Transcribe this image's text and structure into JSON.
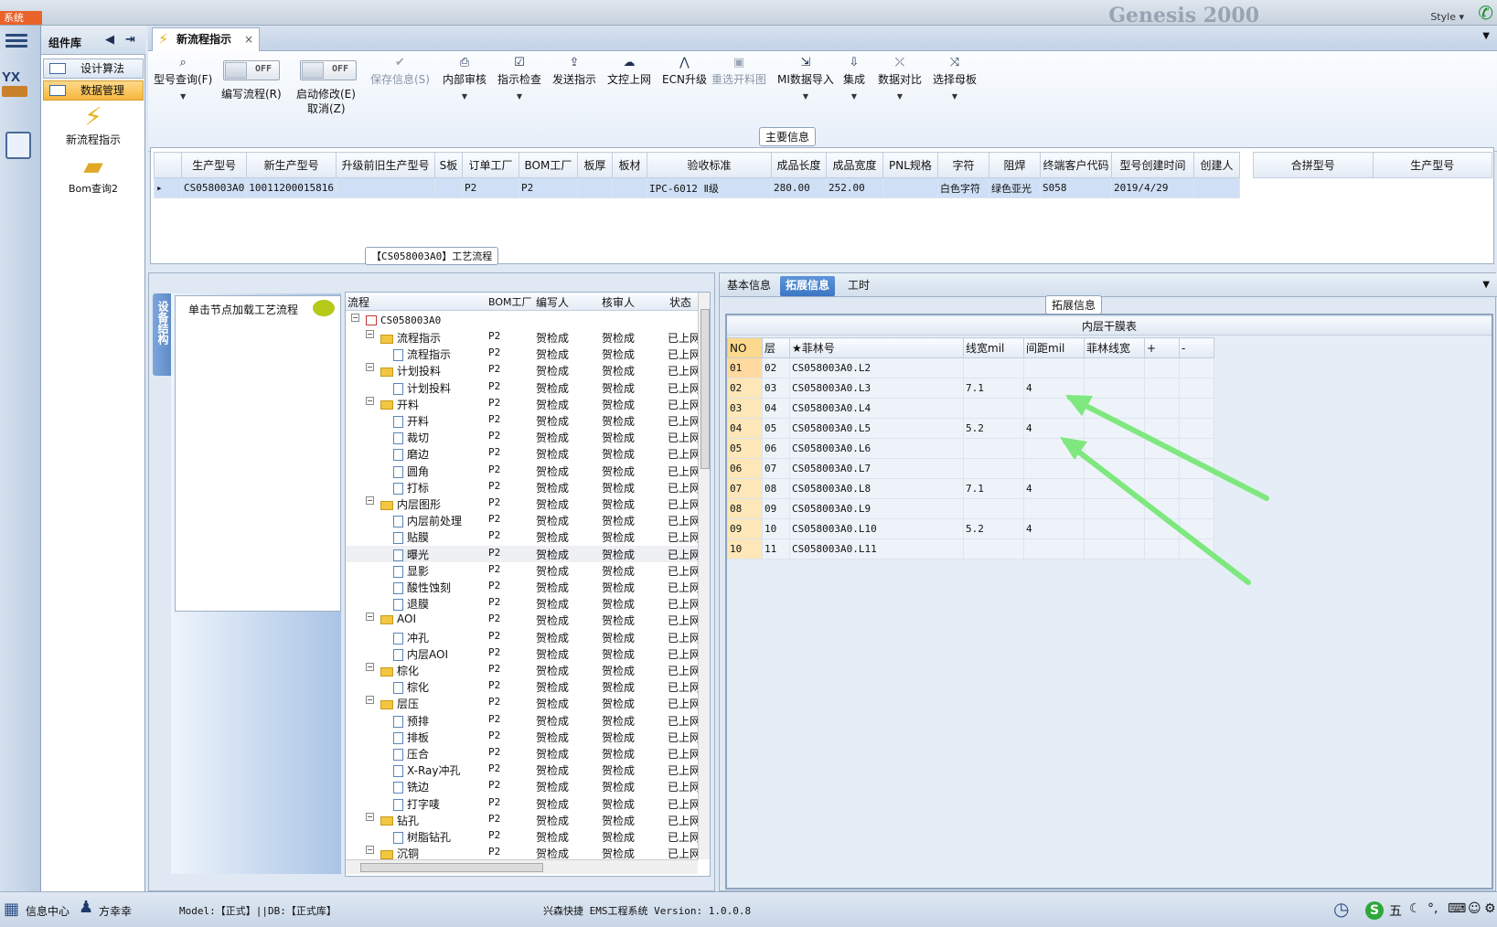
{
  "system_button": "系统",
  "brand_text": "Genesis 2000",
  "style_label": "Style",
  "component_panel": {
    "title": "组件库",
    "items": [
      {
        "label": "设计算法",
        "active": false
      },
      {
        "label": "数据管理",
        "active": true
      }
    ],
    "big_icons": [
      {
        "label": "新流程指示",
        "icon": "lightning-icon"
      },
      {
        "label": "Bom查询2",
        "icon": "folder-icon"
      }
    ]
  },
  "doc_tab": {
    "title": "新流程指示",
    "close": "×"
  },
  "toolbar": {
    "type_query": {
      "label": "型号查询(F)",
      "icon": "search-icon"
    },
    "toggle1": {
      "state": "OFF",
      "label": "编写流程(R)"
    },
    "toggle2": {
      "state": "OFF",
      "label": "启动修改(E)",
      "sub": "取消(Z)"
    },
    "buttons": [
      {
        "label": "保存信息(S)",
        "icon": "check-icon",
        "disabled": true,
        "dropdown": false
      },
      {
        "label": "内部审核",
        "icon": "printer-icon",
        "disabled": false,
        "dropdown": true
      },
      {
        "label": "指示检查",
        "icon": "checkbox-icon",
        "disabled": false,
        "dropdown": true
      },
      {
        "label": "发送指示",
        "icon": "upload-icon",
        "disabled": false,
        "dropdown": false
      },
      {
        "label": "文控上网",
        "icon": "cloud-icon",
        "disabled": false,
        "dropdown": false
      },
      {
        "label": "ECN升级",
        "icon": "ecn-icon",
        "disabled": false,
        "dropdown": false
      },
      {
        "label": "重选开料图",
        "icon": "image-icon",
        "disabled": true,
        "dropdown": false
      },
      {
        "label": "MI数据导入",
        "icon": "import-icon",
        "disabled": false,
        "dropdown": true
      },
      {
        "label": "集成",
        "icon": "download-icon",
        "disabled": false,
        "dropdown": true
      },
      {
        "label": "数据对比",
        "icon": "compare-icon",
        "disabled": false,
        "dropdown": true
      },
      {
        "label": "选择母板",
        "icon": "shuffle-icon",
        "disabled": false,
        "dropdown": true
      }
    ]
  },
  "main_info": {
    "group_label": "主要信息",
    "headers": [
      "生产型号",
      "新生产型号",
      "升级前旧生产型号",
      "S板",
      "订单工厂",
      "BOM工厂",
      "板厚",
      "板材",
      "验收标准",
      "成品长度",
      "成品宽度",
      "PNL规格",
      "字符",
      "阻焊",
      "终端客户代码",
      "型号创建时间",
      "创建人"
    ],
    "rows": [
      [
        "CS058003A0",
        "10011200015816",
        "",
        "",
        "P2",
        "P2",
        "",
        "",
        "IPC-6012 Ⅱ级",
        "280.00",
        "252.00",
        "",
        "白色字符",
        "绿色亚光",
        "S058",
        "2019/4/29",
        ""
      ]
    ],
    "merge_headers": [
      "合拼型号",
      "生产型号"
    ]
  },
  "process_panel": {
    "group_label": "【CS058003A0】工艺流程",
    "side_tab": "设备结构",
    "hint": "单击节点加载工艺流程",
    "tree_headers": [
      "流程",
      "BOM工厂",
      "编写人",
      "核审人",
      "状态"
    ],
    "root": "CS058003A0",
    "rows": [
      {
        "name": "流程指示",
        "type": "folder",
        "bom": "P2",
        "writer": "贺检成",
        "reviewer": "贺检成",
        "status": "已上网"
      },
      {
        "name": "流程指示",
        "type": "file",
        "bom": "P2",
        "writer": "贺检成",
        "reviewer": "贺检成",
        "status": "已上网"
      },
      {
        "name": "计划投料",
        "type": "folder",
        "bom": "P2",
        "writer": "贺检成",
        "reviewer": "贺检成",
        "status": "已上网"
      },
      {
        "name": "计划投料",
        "type": "file",
        "bom": "P2",
        "writer": "贺检成",
        "reviewer": "贺检成",
        "status": "已上网"
      },
      {
        "name": "开料",
        "type": "folder",
        "bom": "P2",
        "writer": "贺检成",
        "reviewer": "贺检成",
        "status": "已上网"
      },
      {
        "name": "开料",
        "type": "file",
        "bom": "P2",
        "writer": "贺检成",
        "reviewer": "贺检成",
        "status": "已上网"
      },
      {
        "name": "裁切",
        "type": "file",
        "bom": "P2",
        "writer": "贺检成",
        "reviewer": "贺检成",
        "status": "已上网"
      },
      {
        "name": "磨边",
        "type": "file",
        "bom": "P2",
        "writer": "贺检成",
        "reviewer": "贺检成",
        "status": "已上网"
      },
      {
        "name": "圆角",
        "type": "file",
        "bom": "P2",
        "writer": "贺检成",
        "reviewer": "贺检成",
        "status": "已上网"
      },
      {
        "name": "打标",
        "type": "file",
        "bom": "P2",
        "writer": "贺检成",
        "reviewer": "贺检成",
        "status": "已上网"
      },
      {
        "name": "内层图形",
        "type": "folder",
        "bom": "P2",
        "writer": "贺检成",
        "reviewer": "贺检成",
        "status": "已上网"
      },
      {
        "name": "内层前处理",
        "type": "file",
        "bom": "P2",
        "writer": "贺检成",
        "reviewer": "贺检成",
        "status": "已上网"
      },
      {
        "name": "贴膜",
        "type": "file",
        "bom": "P2",
        "writer": "贺检成",
        "reviewer": "贺检成",
        "status": "已上网"
      },
      {
        "name": "曝光",
        "type": "file",
        "bom": "P2",
        "writer": "贺检成",
        "reviewer": "贺检成",
        "status": "已上网",
        "highlight": true
      },
      {
        "name": "显影",
        "type": "file",
        "bom": "P2",
        "writer": "贺检成",
        "reviewer": "贺检成",
        "status": "已上网"
      },
      {
        "name": "酸性蚀刻",
        "type": "file",
        "bom": "P2",
        "writer": "贺检成",
        "reviewer": "贺检成",
        "status": "已上网"
      },
      {
        "name": "退膜",
        "type": "file",
        "bom": "P2",
        "writer": "贺检成",
        "reviewer": "贺检成",
        "status": "已上网"
      },
      {
        "name": "AOI",
        "type": "folder",
        "bom": "P2",
        "writer": "贺检成",
        "reviewer": "贺检成",
        "status": "已上网"
      },
      {
        "name": "冲孔",
        "type": "file",
        "bom": "P2",
        "writer": "贺检成",
        "reviewer": "贺检成",
        "status": "已上网"
      },
      {
        "name": "内层AOI",
        "type": "file",
        "bom": "P2",
        "writer": "贺检成",
        "reviewer": "贺检成",
        "status": "已上网"
      },
      {
        "name": "棕化",
        "type": "folder",
        "bom": "P2",
        "writer": "贺检成",
        "reviewer": "贺检成",
        "status": "已上网"
      },
      {
        "name": "棕化",
        "type": "file",
        "bom": "P2",
        "writer": "贺检成",
        "reviewer": "贺检成",
        "status": "已上网"
      },
      {
        "name": "层压",
        "type": "folder",
        "bom": "P2",
        "writer": "贺检成",
        "reviewer": "贺检成",
        "status": "已上网"
      },
      {
        "name": "预排",
        "type": "file",
        "bom": "P2",
        "writer": "贺检成",
        "reviewer": "贺检成",
        "status": "已上网"
      },
      {
        "name": "排板",
        "type": "file",
        "bom": "P2",
        "writer": "贺检成",
        "reviewer": "贺检成",
        "status": "已上网"
      },
      {
        "name": "压合",
        "type": "file",
        "bom": "P2",
        "writer": "贺检成",
        "reviewer": "贺检成",
        "status": "已上网"
      },
      {
        "name": "X-Ray冲孔",
        "type": "file",
        "bom": "P2",
        "writer": "贺检成",
        "reviewer": "贺检成",
        "status": "已上网"
      },
      {
        "name": "铣边",
        "type": "file",
        "bom": "P2",
        "writer": "贺检成",
        "reviewer": "贺检成",
        "status": "已上网"
      },
      {
        "name": "打字唛",
        "type": "file",
        "bom": "P2",
        "writer": "贺检成",
        "reviewer": "贺检成",
        "status": "已上网"
      },
      {
        "name": "钻孔",
        "type": "folder",
        "bom": "P2",
        "writer": "贺检成",
        "reviewer": "贺检成",
        "status": "已上网"
      },
      {
        "name": "树脂钻孔",
        "type": "file",
        "bom": "P2",
        "writer": "贺检成",
        "reviewer": "贺检成",
        "status": "已上网"
      },
      {
        "name": "沉铜",
        "type": "folder",
        "bom": "P2",
        "writer": "贺检成",
        "reviewer": "贺检成",
        "status": "已上网"
      }
    ]
  },
  "ext_panel": {
    "tabs": [
      {
        "label": "基本信息",
        "active": false
      },
      {
        "label": "拓展信息",
        "active": true
      },
      {
        "label": "工时",
        "active": false
      }
    ],
    "group_label": "拓展信息",
    "table_title": "内层干膜表",
    "headers": [
      "NO",
      "层",
      "★菲林号",
      "线宽mil",
      "间距mil",
      "菲林线宽",
      "+",
      "-"
    ],
    "rows": [
      [
        "01",
        "02",
        "CS058003A0.L2",
        "",
        "",
        "",
        "",
        ""
      ],
      [
        "02",
        "03",
        "CS058003A0.L3",
        "7.1",
        "4",
        "",
        "",
        ""
      ],
      [
        "03",
        "04",
        "CS058003A0.L4",
        "",
        "",
        "",
        "",
        ""
      ],
      [
        "04",
        "05",
        "CS058003A0.L5",
        "5.2",
        "4",
        "",
        "",
        ""
      ],
      [
        "05",
        "06",
        "CS058003A0.L6",
        "",
        "",
        "",
        "",
        ""
      ],
      [
        "06",
        "07",
        "CS058003A0.L7",
        "",
        "",
        "",
        "",
        ""
      ],
      [
        "07",
        "08",
        "CS058003A0.L8",
        "7.1",
        "4",
        "",
        "",
        ""
      ],
      [
        "08",
        "09",
        "CS058003A0.L9",
        "",
        "",
        "",
        "",
        ""
      ],
      [
        "09",
        "10",
        "CS058003A0.L10",
        "5.2",
        "4",
        "",
        "",
        ""
      ],
      [
        "10",
        "11",
        "CS058003A0.L11",
        "",
        "",
        "",
        "",
        ""
      ]
    ],
    "annotation_color": "#7ee87e"
  },
  "status_bar": {
    "info_center": "信息中心",
    "user": "方幸幸",
    "model_db": "Model:【正式】||DB:【正式库】",
    "system": "兴森快捷 EMS工程系统 Version: 1.0.0.8",
    "ime": "五"
  }
}
